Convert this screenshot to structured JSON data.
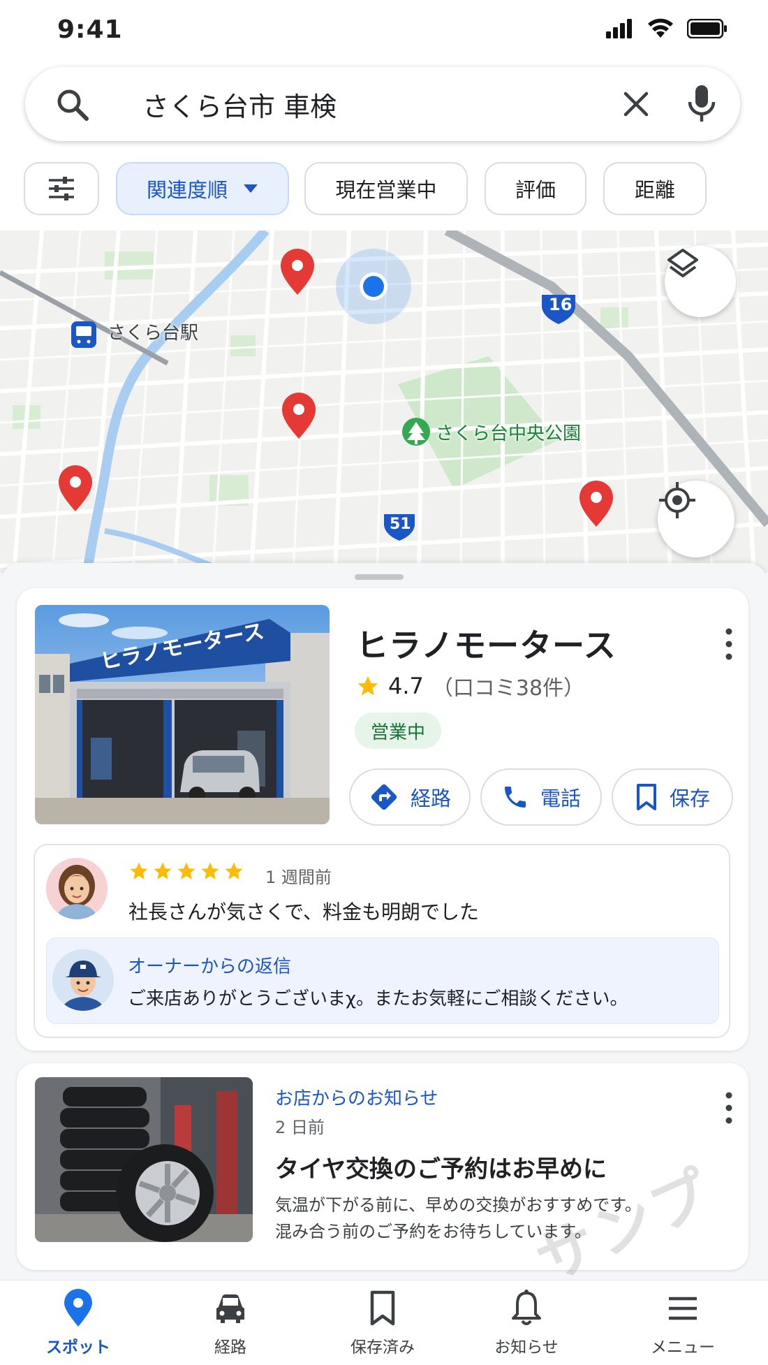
{
  "status_bar": {
    "time": "9:41"
  },
  "search": {
    "query": "さくら台市 車検"
  },
  "filters": {
    "chips": [
      {
        "label": "関連度順"
      },
      {
        "label": "現在営業中"
      },
      {
        "label": "評価"
      },
      {
        "label": "距離"
      }
    ]
  },
  "map": {
    "station_label": "さくら台駅",
    "park_label": "さくら台中央公園",
    "route_badges": [
      "16",
      "51"
    ]
  },
  "shop": {
    "name": "ヒラノモータース",
    "sign_text": "ヒラノモータース",
    "rating": "4.7",
    "review_count": "（口コミ38件）",
    "status": "営業中",
    "actions": [
      {
        "label": "経路",
        "icon": "directions-icon"
      },
      {
        "label": "電話",
        "icon": "phone-icon"
      },
      {
        "label": "保存",
        "icon": "bookmark-icon"
      }
    ]
  },
  "review": {
    "stars": 5,
    "time": "1 週間前",
    "text": "社長さんが気さくで、料金も明朗でした",
    "owner_reply_label": "オーナーからの返信",
    "owner_reply_text": "ご来店ありがとうございまχ。またお気軽にご相談ください。"
  },
  "notice": {
    "label": "お店からのお知らせ",
    "date": "2 日前",
    "title": "タイヤ交換のご予約はお早めに",
    "body_line1": "気温が下がる前に、早めの交換がおすすめです。",
    "body_line2": "混み合う前のご予約をお待ちしています。"
  },
  "watermark": "サンプル",
  "bottom_nav": {
    "items": [
      {
        "label": "スポット",
        "icon": "place-icon"
      },
      {
        "label": "経路",
        "icon": "car-icon"
      },
      {
        "label": "保存済み",
        "icon": "bookmark-icon"
      },
      {
        "label": "お知らせ",
        "icon": "bell-icon"
      },
      {
        "label": "メニュー",
        "icon": "menu-icon"
      }
    ]
  },
  "colors": {
    "accent": "#1a73e8",
    "pin": "#ea4335",
    "open_green": "#137333",
    "star": "#fbbc04"
  }
}
